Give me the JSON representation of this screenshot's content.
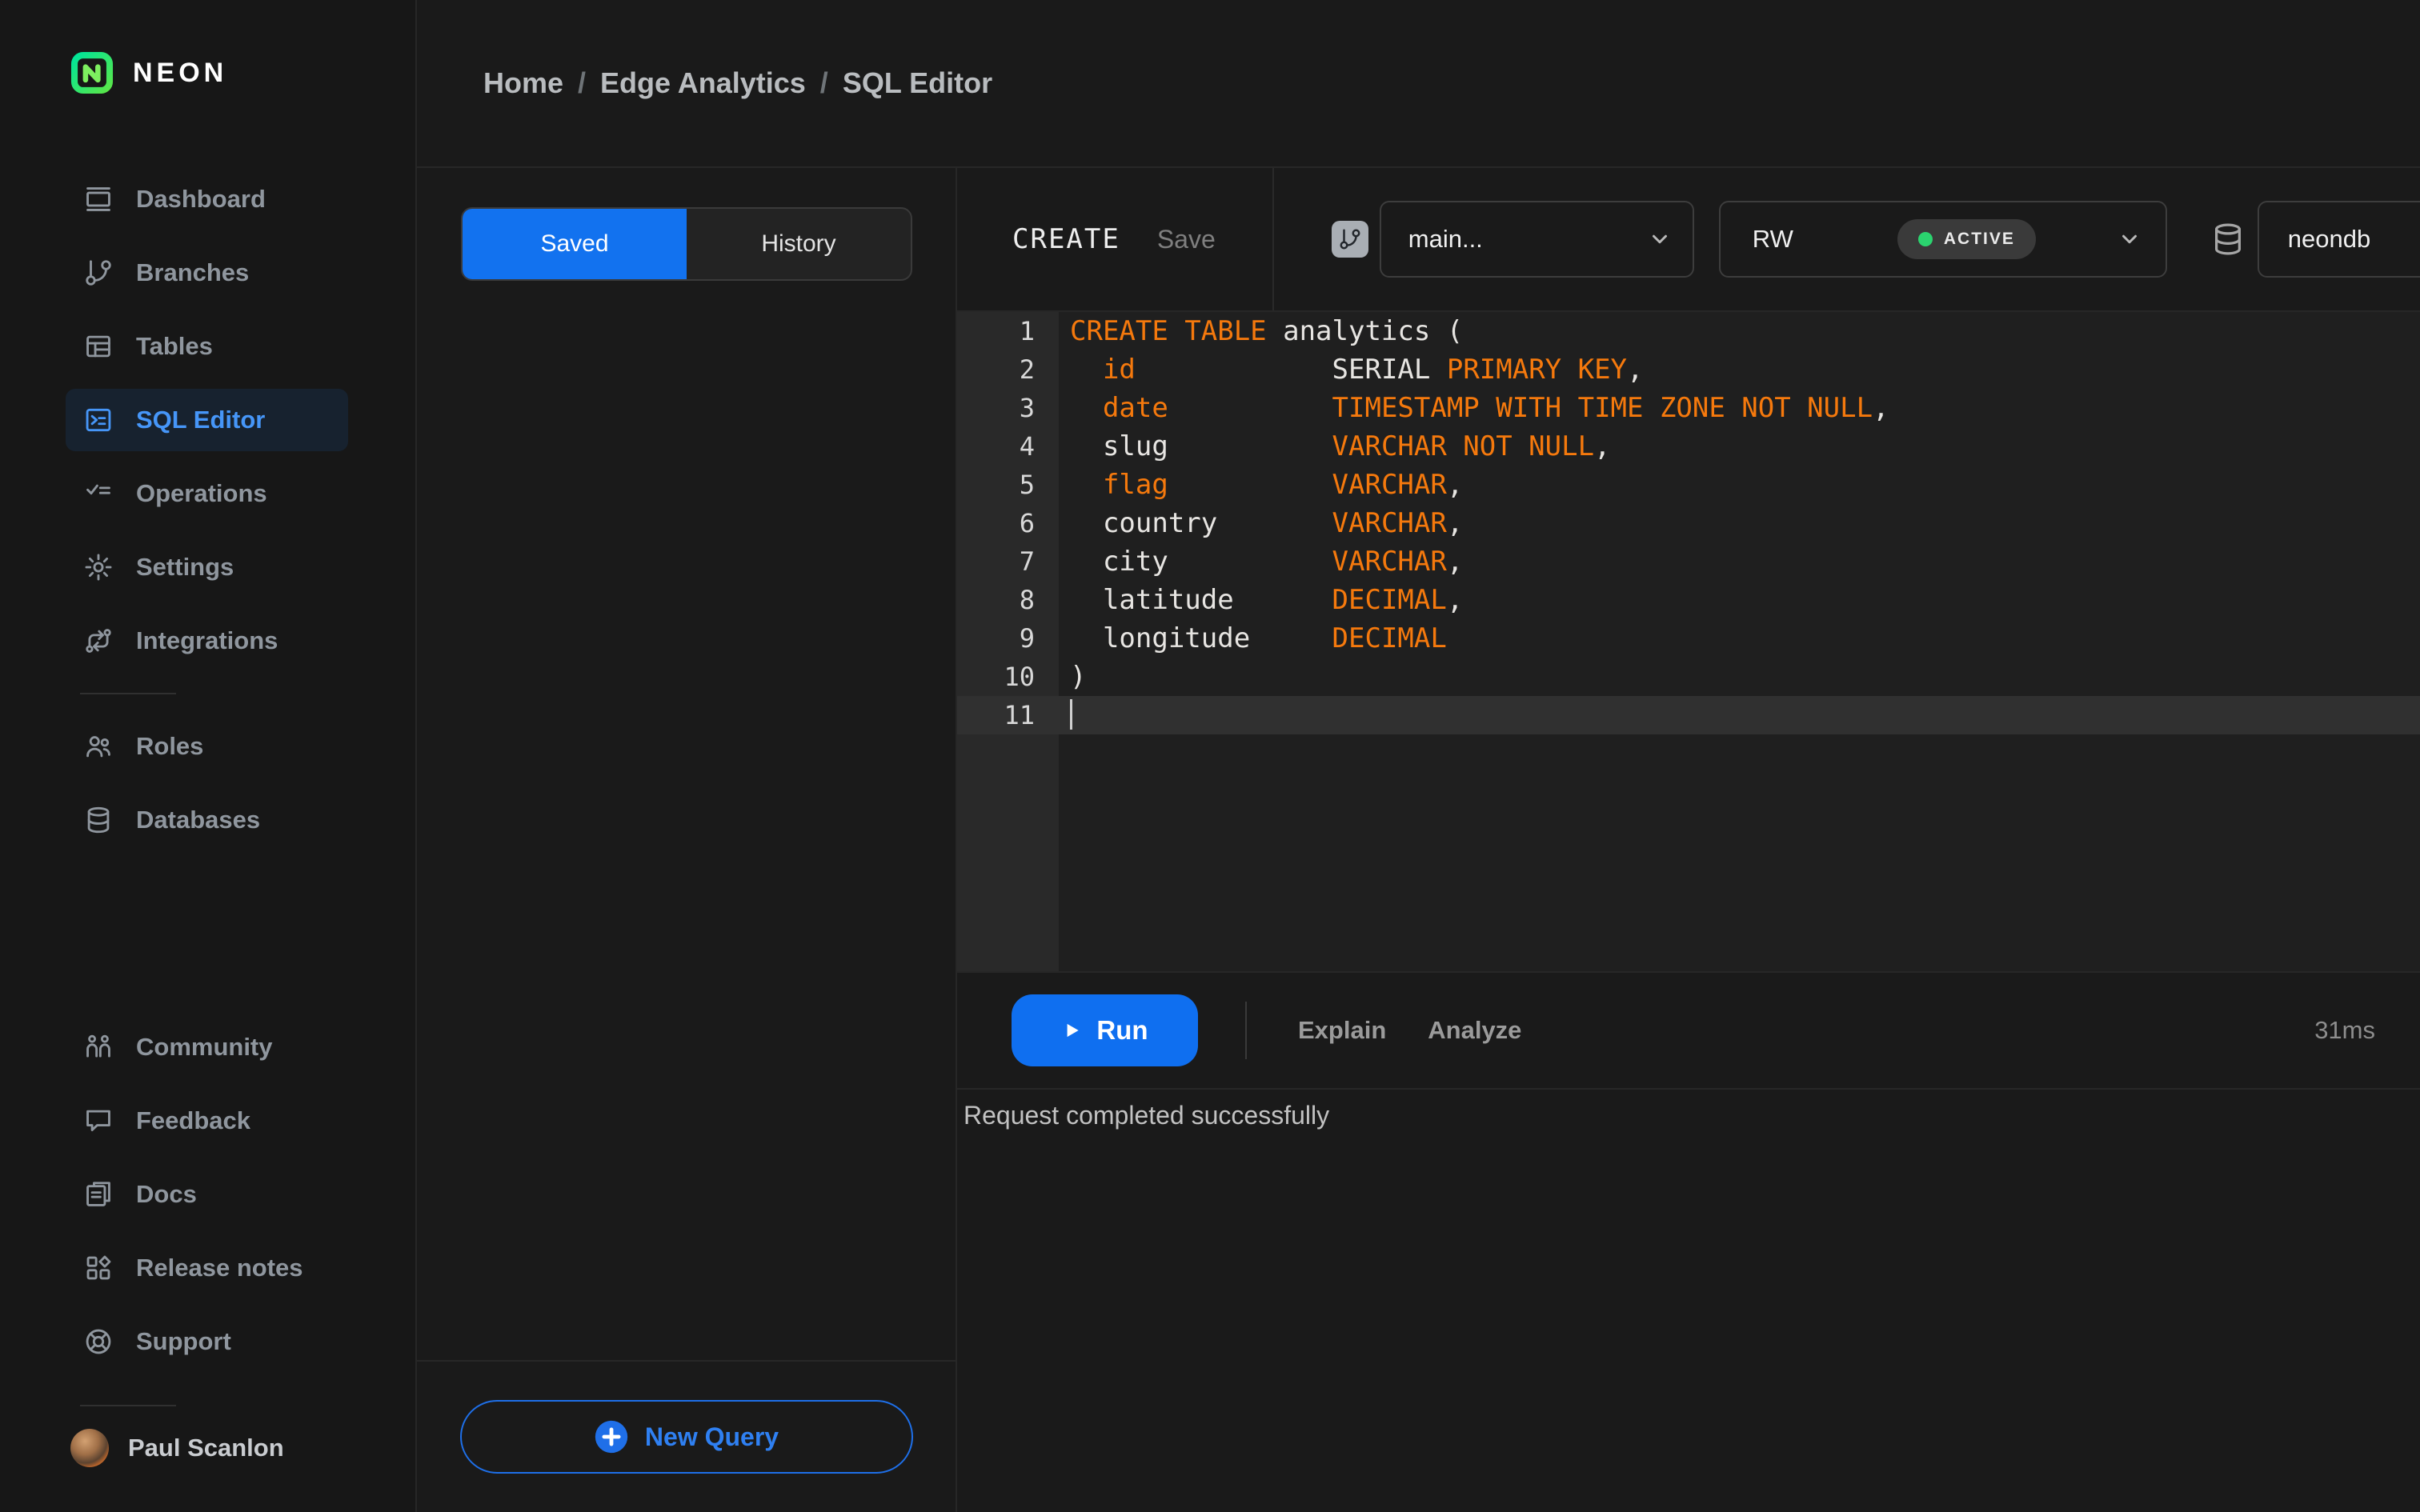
{
  "brand": {
    "name": "NEON"
  },
  "breadcrumb": {
    "separator": "/",
    "items": [
      {
        "label": "Home"
      },
      {
        "label": "Edge Analytics"
      },
      {
        "label": "SQL Editor"
      }
    ]
  },
  "sidebar": {
    "sections": {
      "primary": [
        {
          "label": "Dashboard",
          "icon": "dashboard-icon"
        },
        {
          "label": "Branches",
          "icon": "branches-icon"
        },
        {
          "label": "Tables",
          "icon": "tables-icon"
        },
        {
          "label": "SQL Editor",
          "icon": "sql-editor-icon",
          "active": true
        },
        {
          "label": "Operations",
          "icon": "operations-icon"
        },
        {
          "label": "Settings",
          "icon": "settings-icon"
        },
        {
          "label": "Integrations",
          "icon": "integrations-icon"
        }
      ],
      "secondary": [
        {
          "label": "Roles",
          "icon": "roles-icon"
        },
        {
          "label": "Databases",
          "icon": "databases-icon"
        }
      ],
      "tertiary": [
        {
          "label": "Community",
          "icon": "community-icon"
        },
        {
          "label": "Feedback",
          "icon": "feedback-icon"
        },
        {
          "label": "Docs",
          "icon": "docs-icon"
        },
        {
          "label": "Release notes",
          "icon": "release-notes-icon"
        },
        {
          "label": "Support",
          "icon": "support-icon"
        }
      ]
    },
    "user": {
      "name": "Paul Scanlon"
    }
  },
  "queries_panel": {
    "tabs": [
      {
        "label": "Saved",
        "active": true
      },
      {
        "label": "History",
        "active": false
      }
    ],
    "new_query_label": "New Query"
  },
  "editor": {
    "query_title": "CREATE",
    "save_label": "Save",
    "branch_select": {
      "value": "main..."
    },
    "compute_select": {
      "value": "RW",
      "status_badge": "ACTIVE"
    },
    "database_select": {
      "value": "neondb"
    },
    "code": {
      "language": "sql",
      "lines": [
        {
          "n": 1,
          "tokens": [
            [
              "kw",
              "CREATE TABLE"
            ],
            [
              "pl",
              " analytics ("
            ]
          ]
        },
        {
          "n": 2,
          "tokens": [
            [
              "pl",
              "  "
            ],
            [
              "kw",
              "id"
            ],
            [
              "pl",
              "            "
            ],
            [
              "pl",
              "SERIAL "
            ],
            [
              "kw",
              "PRIMARY KEY"
            ],
            [
              "pl",
              ","
            ]
          ]
        },
        {
          "n": 3,
          "tokens": [
            [
              "pl",
              "  "
            ],
            [
              "kw",
              "date"
            ],
            [
              "pl",
              "          "
            ],
            [
              "kw",
              "TIMESTAMP WITH TIME ZONE NOT NULL"
            ],
            [
              "pl",
              ","
            ]
          ]
        },
        {
          "n": 4,
          "tokens": [
            [
              "pl",
              "  slug"
            ],
            [
              "pl",
              "          "
            ],
            [
              "kw",
              "VARCHAR NOT NULL"
            ],
            [
              "pl",
              ","
            ]
          ]
        },
        {
          "n": 5,
          "tokens": [
            [
              "pl",
              "  "
            ],
            [
              "kw",
              "flag"
            ],
            [
              "pl",
              "          "
            ],
            [
              "kw",
              "VARCHAR"
            ],
            [
              "pl",
              ","
            ]
          ]
        },
        {
          "n": 6,
          "tokens": [
            [
              "pl",
              "  country"
            ],
            [
              "pl",
              "       "
            ],
            [
              "kw",
              "VARCHAR"
            ],
            [
              "pl",
              ","
            ]
          ]
        },
        {
          "n": 7,
          "tokens": [
            [
              "pl",
              "  city"
            ],
            [
              "pl",
              "          "
            ],
            [
              "kw",
              "VARCHAR"
            ],
            [
              "pl",
              ","
            ]
          ]
        },
        {
          "n": 8,
          "tokens": [
            [
              "pl",
              "  latitude"
            ],
            [
              "pl",
              "      "
            ],
            [
              "kw",
              "DECIMAL"
            ],
            [
              "pl",
              ","
            ]
          ]
        },
        {
          "n": 9,
          "tokens": [
            [
              "pl",
              "  longitude"
            ],
            [
              "pl",
              "     "
            ],
            [
              "kw",
              "DECIMAL"
            ]
          ]
        },
        {
          "n": 10,
          "tokens": [
            [
              "pl",
              ")"
            ]
          ]
        },
        {
          "n": 11,
          "tokens": [],
          "current": true
        }
      ]
    }
  },
  "run_bar": {
    "run_label": "Run",
    "explain_label": "Explain",
    "analyze_label": "Analyze",
    "duration": "31ms"
  },
  "results": {
    "message": "Request completed successfully"
  },
  "colors": {
    "accent_blue": "#1272ef",
    "keyword_orange": "#f5790d",
    "status_green": "#2bd46f",
    "brand_green": "#00e599"
  }
}
